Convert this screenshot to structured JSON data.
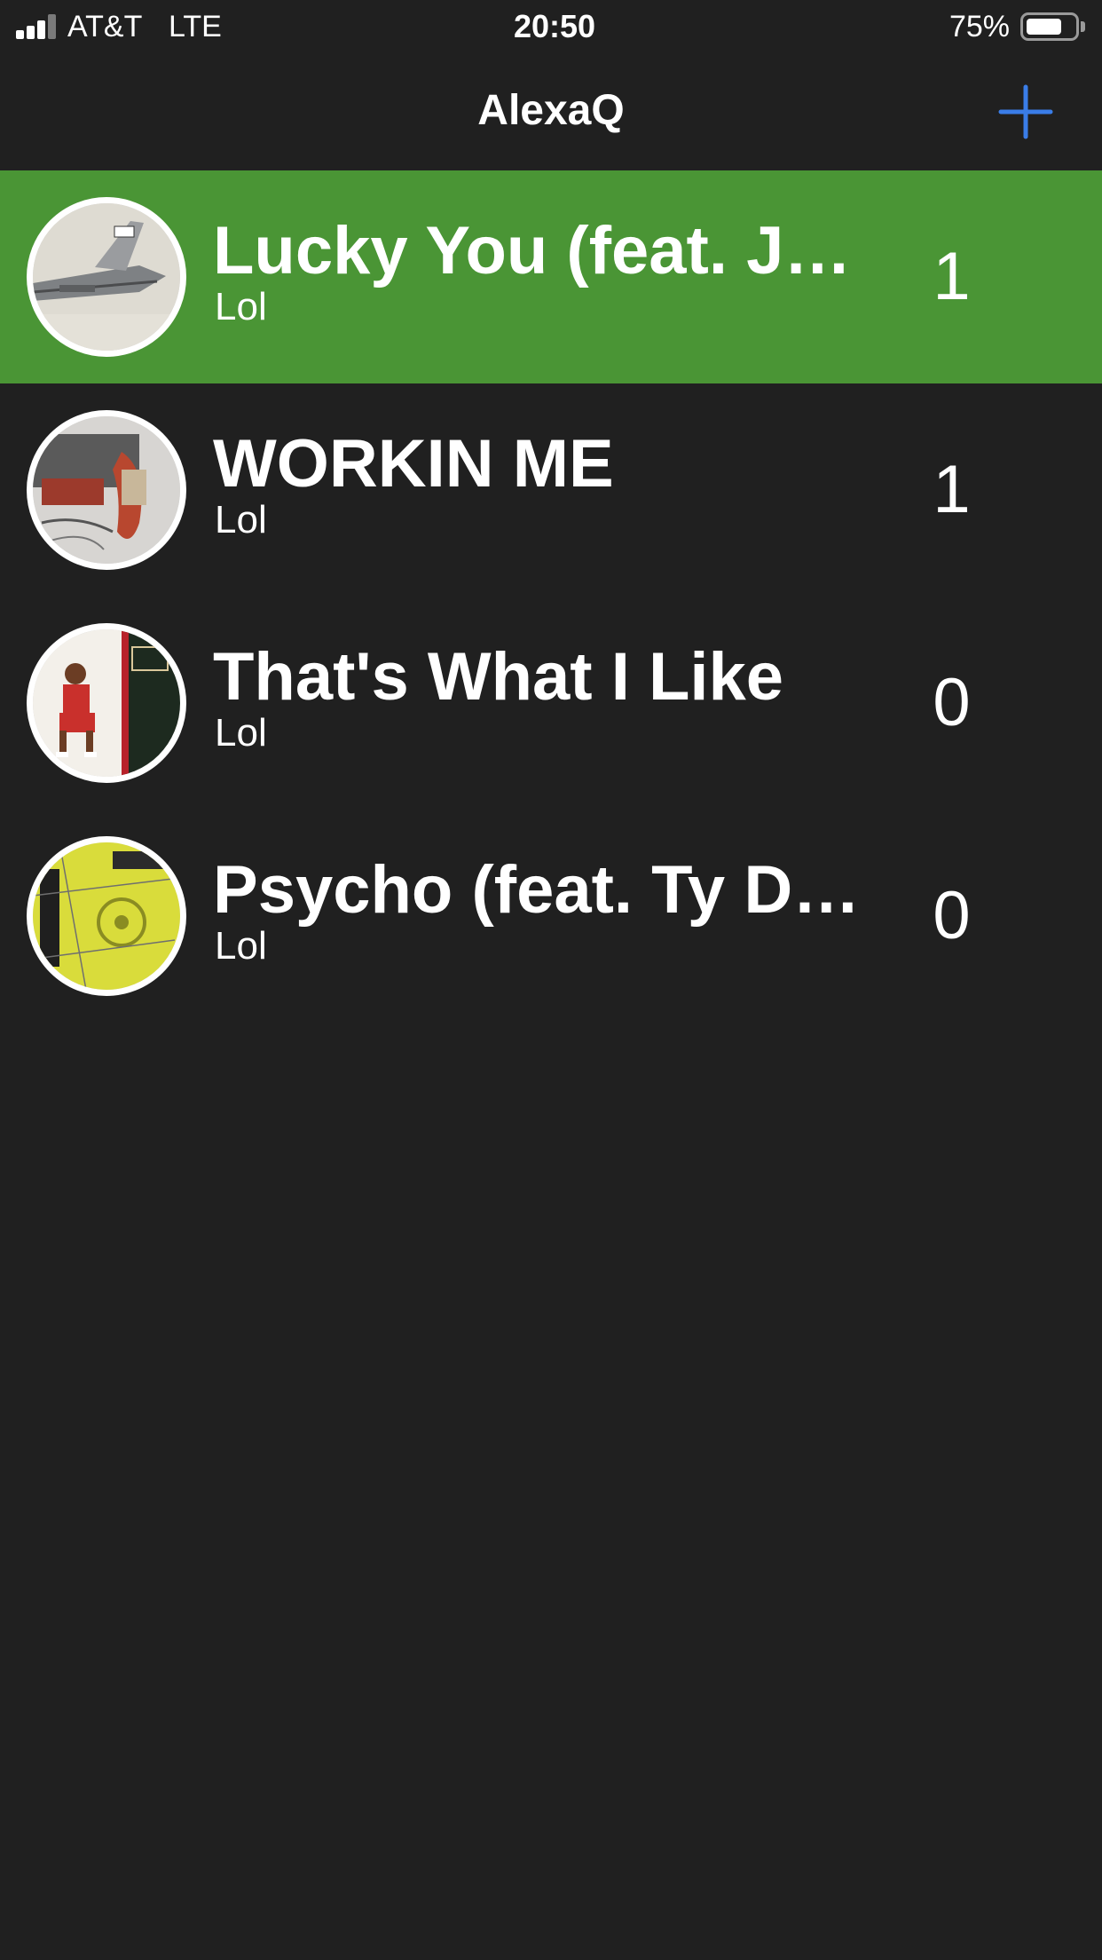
{
  "status_bar": {
    "carrier": "AT&T",
    "network": "LTE",
    "time": "20:50",
    "battery_percent": "75%",
    "battery_level": 0.75,
    "signal_bars": 3
  },
  "nav": {
    "title": "AlexaQ",
    "add_icon": "plus-icon",
    "accent_color": "#3a7de8"
  },
  "colors": {
    "background": "#202020",
    "active_row": "#4a9535"
  },
  "songs": [
    {
      "title": "Lucky You (feat. Joyner Lucas)",
      "artist": "Lol",
      "votes": "1",
      "active": true,
      "cover_icon": "album-cover-kamikaze"
    },
    {
      "title": "WORKIN ME",
      "artist": "Lol",
      "votes": "1",
      "active": false,
      "cover_icon": "album-cover-workin-me"
    },
    {
      "title": "That's What I Like",
      "artist": "Lol",
      "votes": "0",
      "active": false,
      "cover_icon": "album-cover-24k-magic"
    },
    {
      "title": "Psycho (feat. Ty Dolla $ign)",
      "artist": "Lol",
      "votes": "0",
      "active": false,
      "cover_icon": "album-cover-beerbongs"
    }
  ]
}
